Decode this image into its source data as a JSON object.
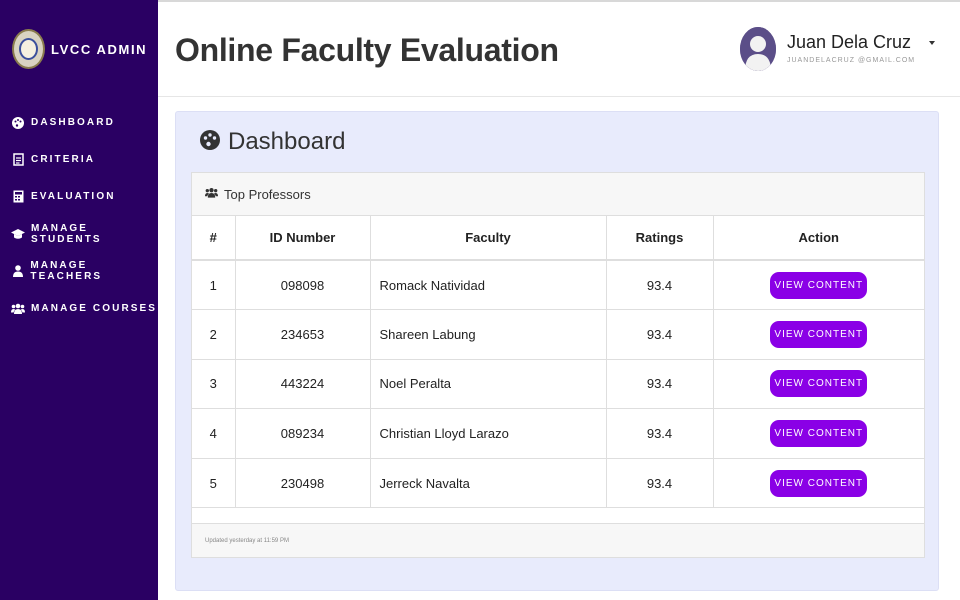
{
  "brand": {
    "name": "LVCC ADMIN"
  },
  "sidebar": {
    "items": [
      {
        "label": "DASHBOARD",
        "icon": "palette-icon"
      },
      {
        "label": "CRITERIA",
        "icon": "document-icon"
      },
      {
        "label": "EVALUATION",
        "icon": "calculator-icon"
      },
      {
        "label": "MANAGE STUDENTS",
        "icon": "graduation-cap-icon"
      },
      {
        "label": "MANAGE TEACHERS",
        "icon": "user-icon"
      },
      {
        "label": "MANAGE COURSES",
        "icon": "users-icon"
      }
    ]
  },
  "header": {
    "title": "Online Faculty Evaluation",
    "user_name": "Juan Dela Cruz",
    "user_email": "JUANDELACRUZ @GMAIL.COM"
  },
  "dashboard": {
    "title": "Dashboard"
  },
  "card": {
    "title": "Top Professors",
    "footer": "Updated yesterday at 11:59 PM"
  },
  "table": {
    "columns": [
      "#",
      "ID Number",
      "Faculty",
      "Ratings",
      "Action"
    ],
    "rows": [
      {
        "num": "1",
        "id": "098098",
        "faculty": "Romack Natividad",
        "rating": "93.4",
        "action": "VIEW CONTENT"
      },
      {
        "num": "2",
        "id": "234653",
        "faculty": "Shareen Labung",
        "rating": "93.4",
        "action": "VIEW CONTENT"
      },
      {
        "num": "3",
        "id": "443224",
        "faculty": "Noel Peralta",
        "rating": "93.4",
        "action": "VIEW CONTENT"
      },
      {
        "num": "4",
        "id": "089234",
        "faculty": "Christian Lloyd Larazo",
        "rating": "93.4",
        "action": "VIEW CONTENT"
      },
      {
        "num": "5",
        "id": "230498",
        "faculty": "Jerreck Navalta",
        "rating": "93.4",
        "action": "VIEW CONTENT"
      }
    ]
  },
  "colors": {
    "sidebar_bg": "#2a0063",
    "accent_button": "#8a00e6",
    "panel_bg": "#e8ebfc"
  }
}
